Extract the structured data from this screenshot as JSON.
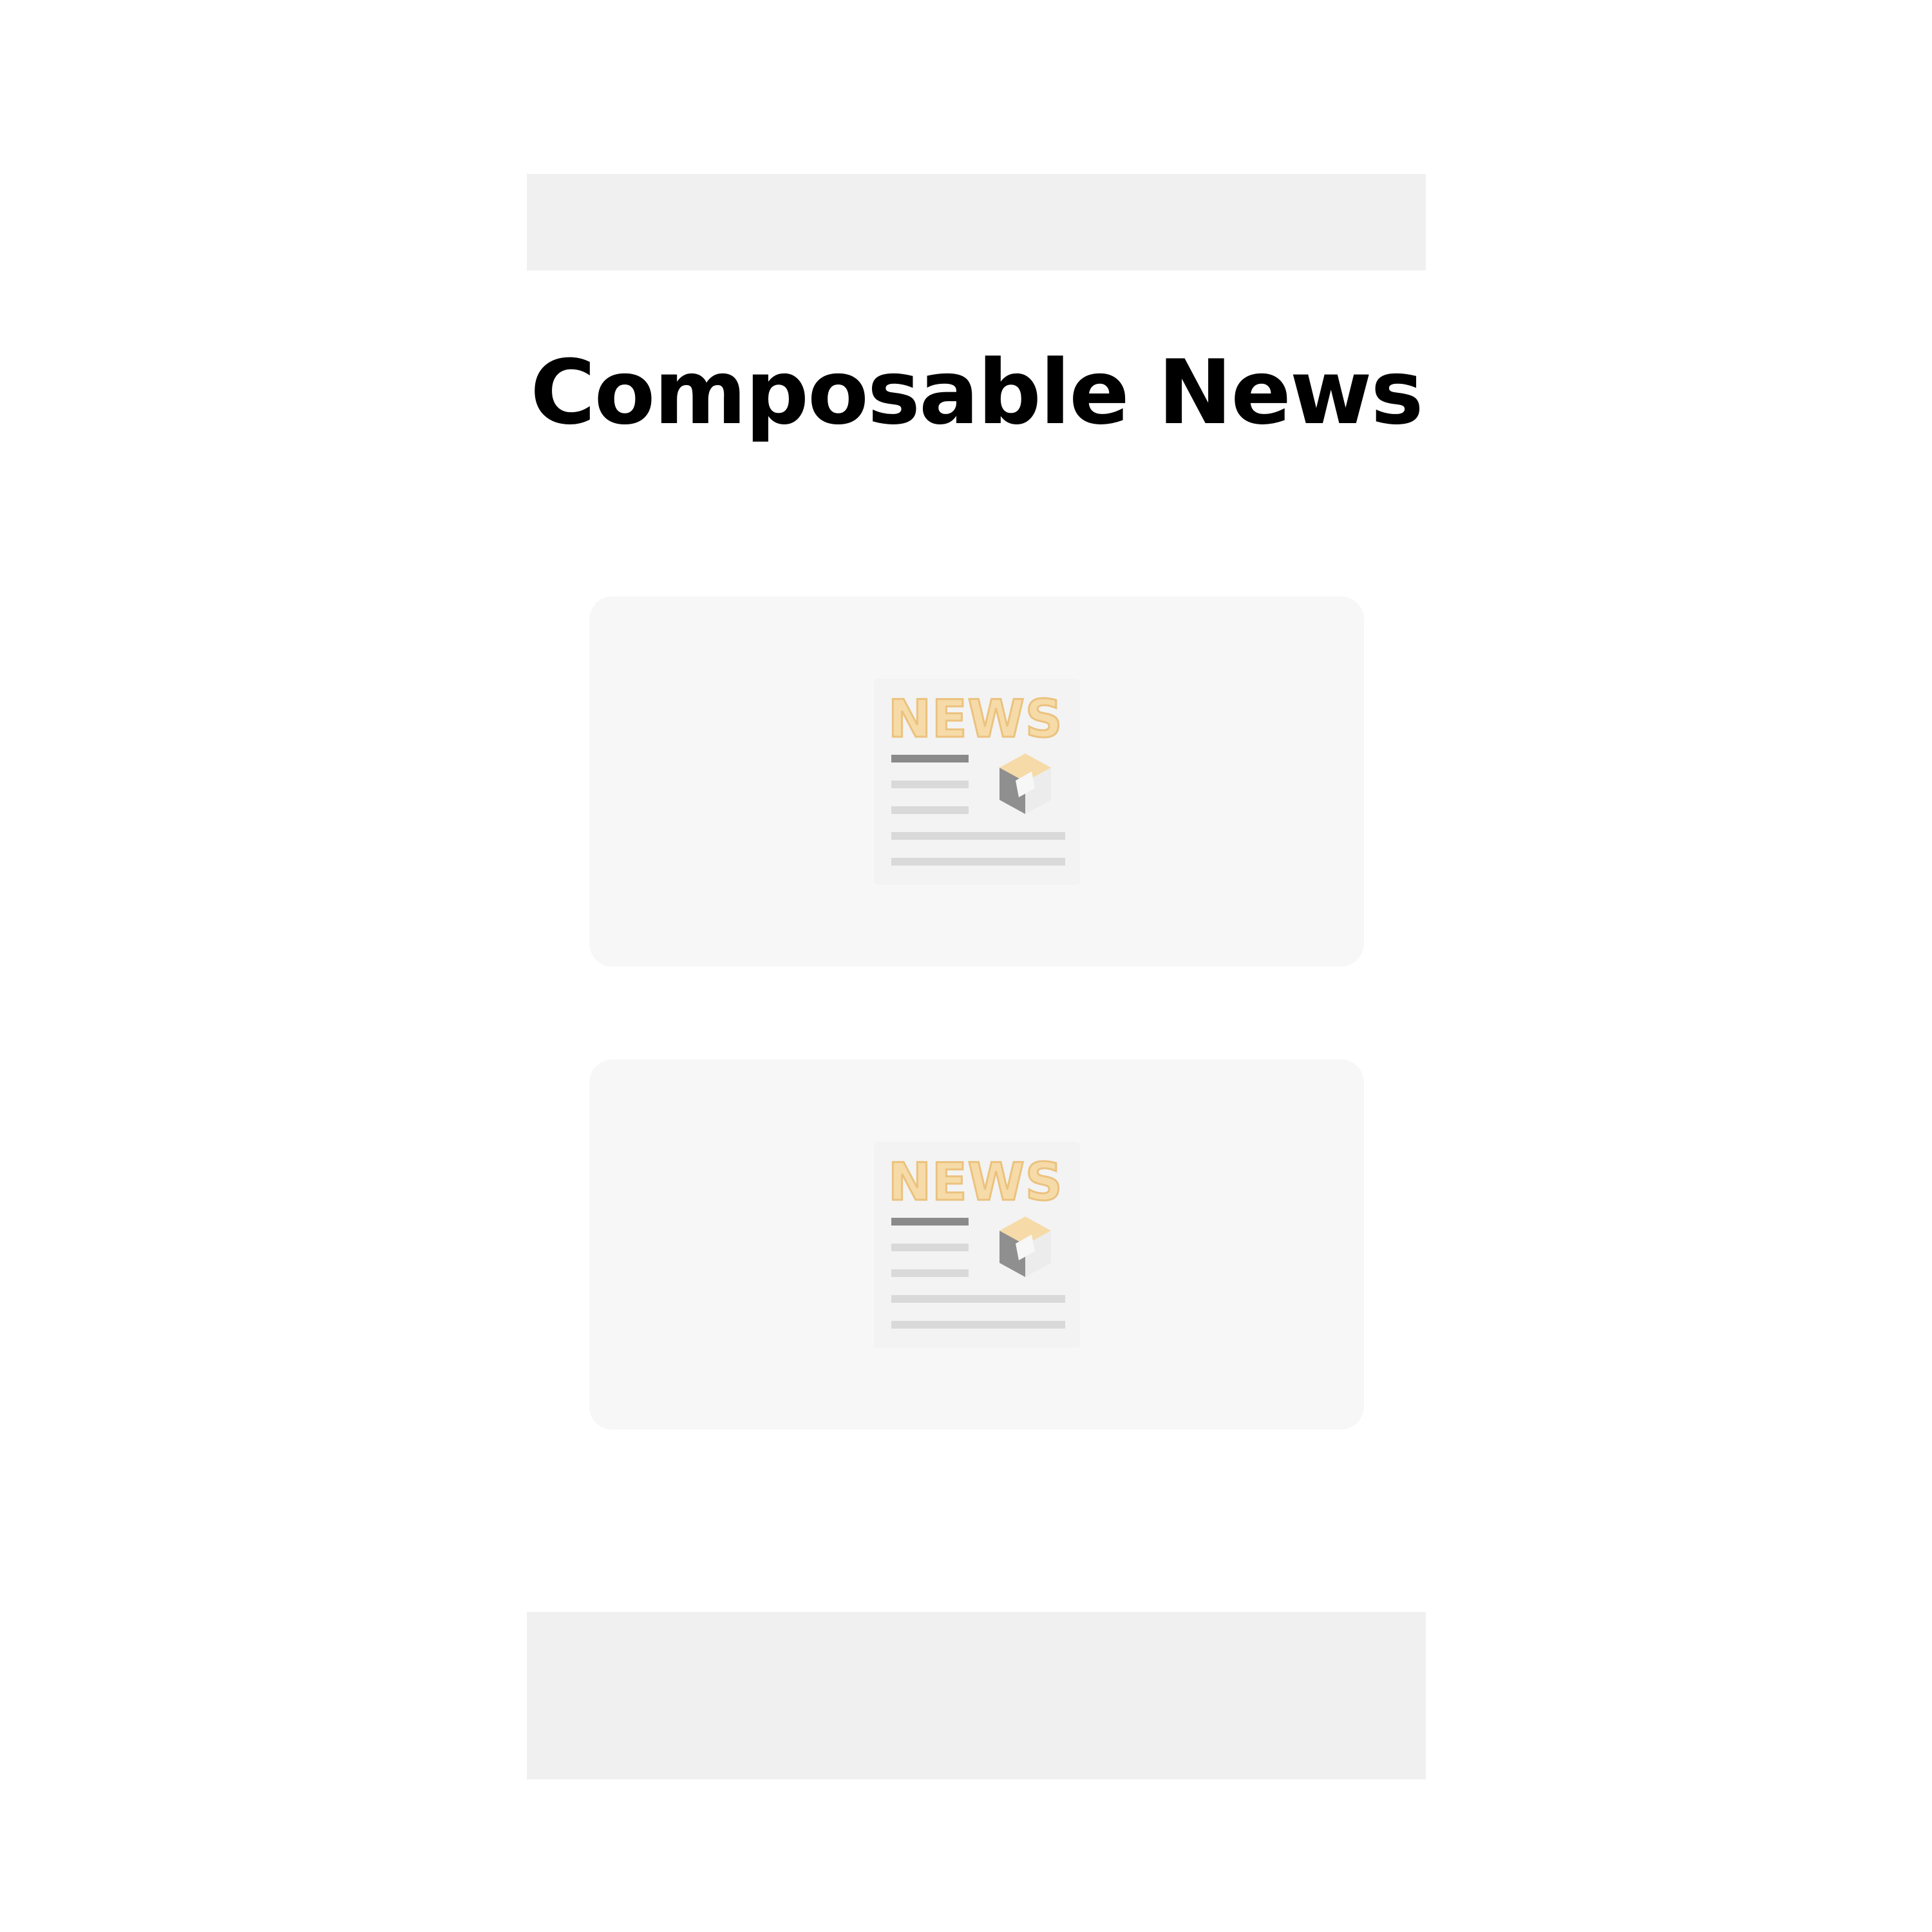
{
  "page": {
    "title": "Composable News"
  },
  "news_cards": [
    {
      "image_word": "NEWS",
      "icon": "news-placeholder-icon"
    },
    {
      "image_word": "NEWS",
      "icon": "news-placeholder-icon"
    }
  ],
  "colors": {
    "background": "#ffffff",
    "header_bar": "#f0f0f0",
    "footer_bar": "#f0f0f0",
    "card_background": "#f7f7f7",
    "news_word_fill": "#f6dba8",
    "news_word_stroke": "#ebc27e",
    "title_text": "#000000"
  }
}
